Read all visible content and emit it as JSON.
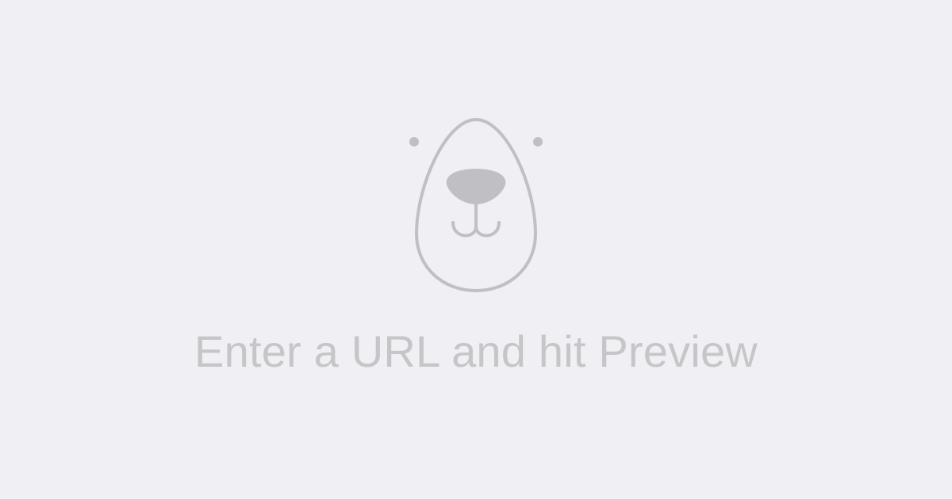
{
  "empty_state": {
    "icon": "bear-face-icon",
    "message": "Enter a URL and hit Preview"
  },
  "colors": {
    "background": "#f0f0f4",
    "icon": "#c0c0c4",
    "text": "#c6c6c9"
  }
}
